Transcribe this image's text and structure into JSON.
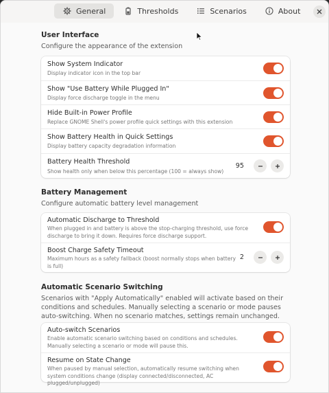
{
  "tabs": [
    {
      "label": "General",
      "icon": "gear-icon",
      "active": true
    },
    {
      "label": "Thresholds",
      "icon": "battery-icon",
      "active": false
    },
    {
      "label": "Scenarios",
      "icon": "list-icon",
      "active": false
    },
    {
      "label": "About",
      "icon": "info-icon",
      "active": false
    }
  ],
  "sections": {
    "ui": {
      "title": "User Interface",
      "desc": "Configure the appearance of the extension",
      "rows": [
        {
          "title": "Show System Indicator",
          "sub": "Display indicator icon in the top bar",
          "on": true
        },
        {
          "title": "Show \"Use Battery While Plugged In\"",
          "sub": "Display force discharge toggle in the menu",
          "on": true
        },
        {
          "title": "Hide Built-in Power Profile",
          "sub": "Replace GNOME Shell's power profile quick settings with this extension",
          "on": true
        },
        {
          "title": "Show Battery Health in Quick Settings",
          "sub": "Display battery capacity degradation information",
          "on": true
        },
        {
          "title": "Battery Health Threshold",
          "sub": "Show health only when below this percentage (100 = always show)",
          "value": "95"
        }
      ]
    },
    "battery": {
      "title": "Battery Management",
      "desc": "Configure automatic battery level management",
      "rows": [
        {
          "title": "Automatic Discharge to Threshold",
          "sub": "When plugged in and battery is above the stop-charging threshold, use force discharge to bring it down. Requires force discharge support.",
          "on": true
        },
        {
          "title": "Boost Charge Safety Timeout",
          "sub": "Maximum hours as a safety fallback (boost normally stops when battery is full)",
          "value": "2"
        }
      ]
    },
    "scenario": {
      "title": "Automatic Scenario Switching",
      "desc": "Scenarios with \"Apply Automatically\" enabled will activate based on their conditions and schedules. Manually selecting a scenario or mode pauses auto-switching. When no scenario matches, settings remain unchanged.",
      "rows": [
        {
          "title": "Auto-switch Scenarios",
          "sub": "Enable automatic scenario switching based on conditions and schedules. Manually selecting a scenario or mode will pause this.",
          "on": true
        },
        {
          "title": "Resume on State Change",
          "sub": "When paused by manual selection, automatically resume switching when system conditions change (display connected/disconnected, AC plugged/unplugged)",
          "on": true
        }
      ]
    }
  },
  "colors": {
    "accent": "#e0552d",
    "background": "#fafafa",
    "card": "#ffffff"
  }
}
